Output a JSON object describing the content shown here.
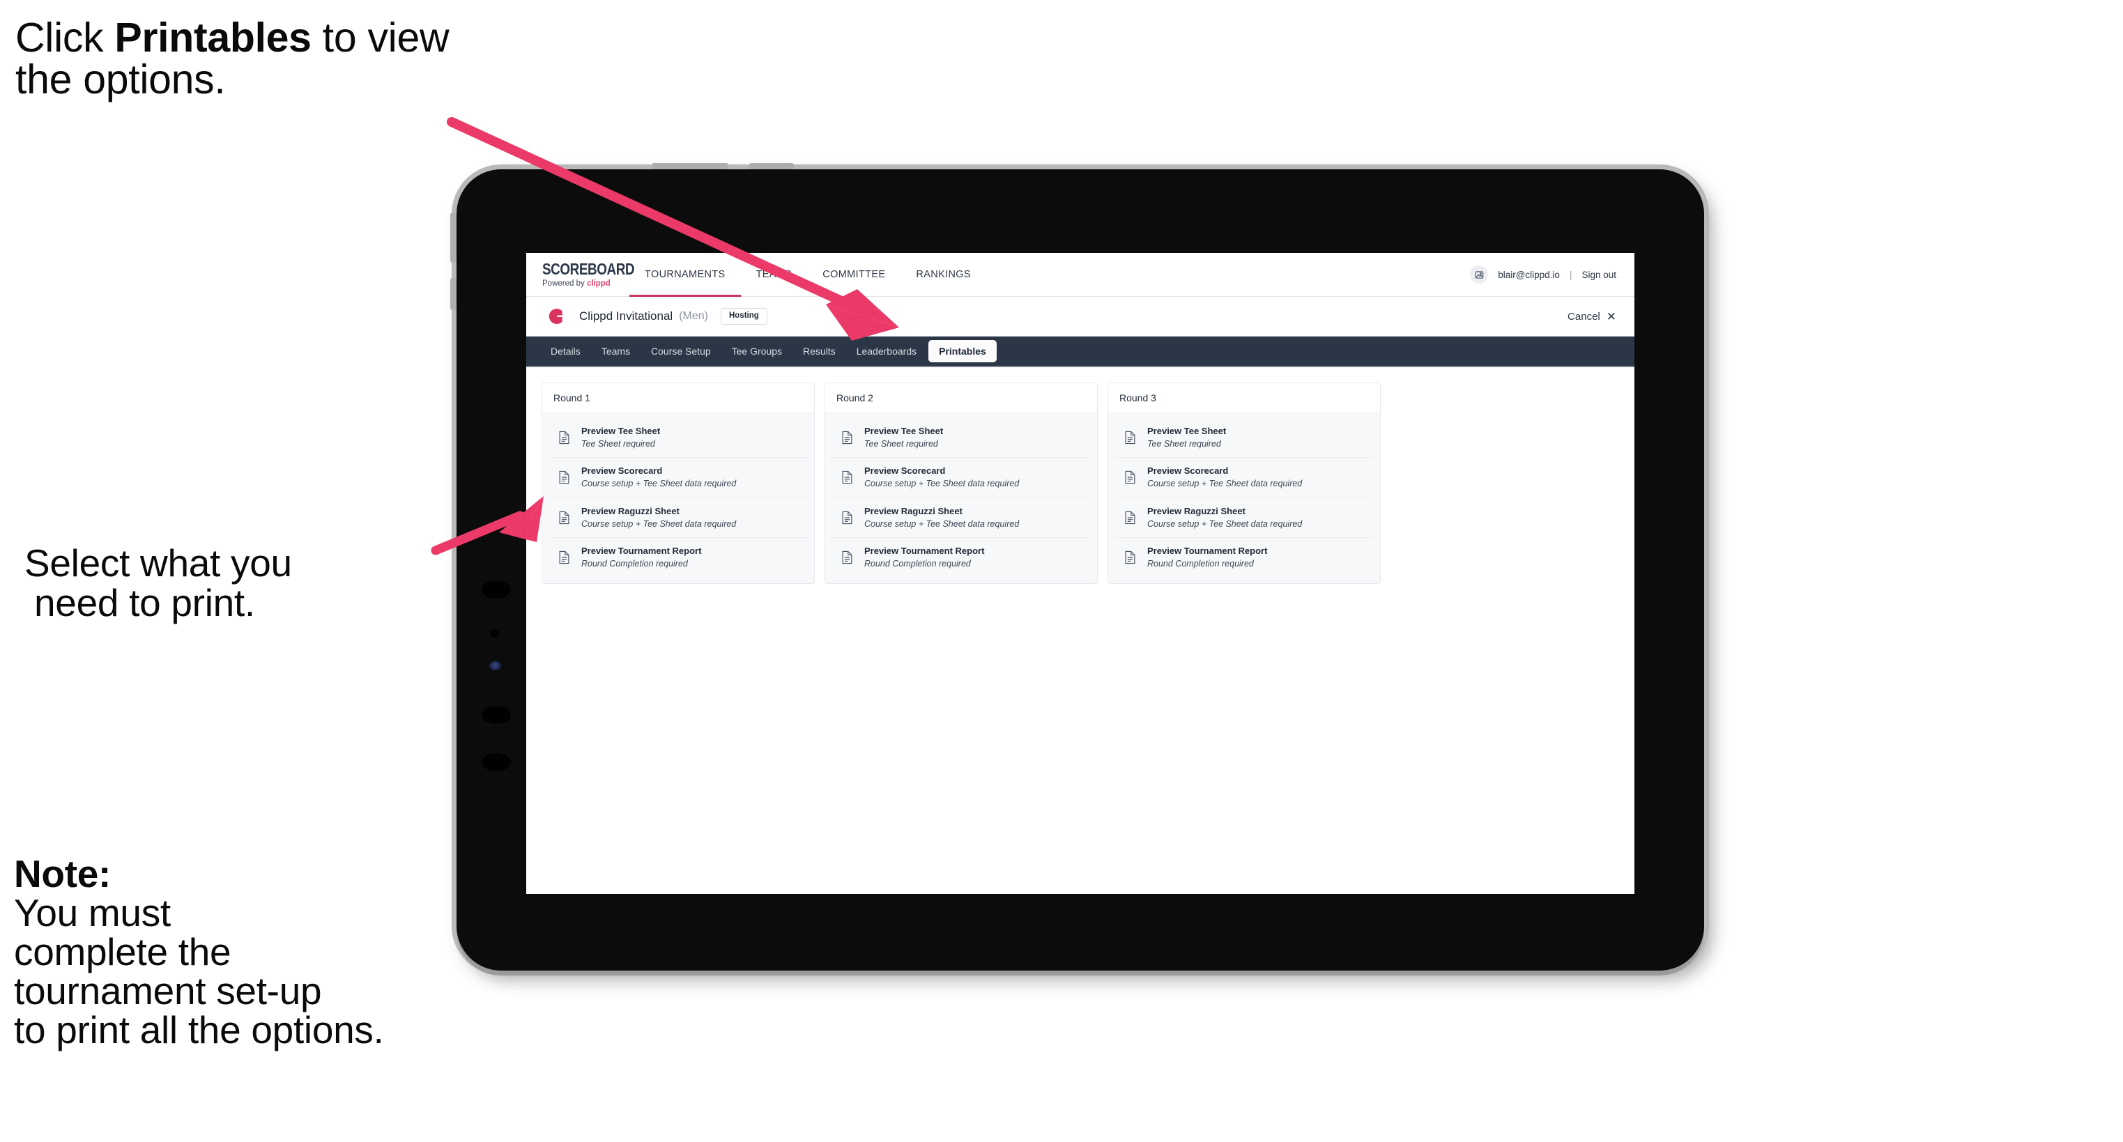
{
  "annotations": {
    "step1": {
      "pre": "Click ",
      "bold": "Printables",
      "post": " to view the options."
    },
    "step2_line1": "Select what you",
    "step2_line2": "need to print.",
    "note": {
      "bold": "Note:",
      "line1": " You must",
      "line2": "complete the",
      "line3": "tournament set-up",
      "line4": "to print all the options."
    }
  },
  "colors": {
    "accent_pink": "#ec3a68",
    "nav_dark": "#2b3647",
    "brand_red": "#e8456c",
    "tab_underline": "#c2385c"
  },
  "app": {
    "brand": {
      "word": "SCOREBOARD",
      "powered_by": "Powered by ",
      "powered_brand": "clippd"
    },
    "main_nav": [
      {
        "label": "TOURNAMENTS",
        "active": true
      },
      {
        "label": "TEAMS",
        "active": false
      },
      {
        "label": "COMMITTEE",
        "active": false
      },
      {
        "label": "RANKINGS",
        "active": false
      }
    ],
    "account": {
      "icon": "user-avatar-icon",
      "email": "blair@clippd.io",
      "separator": "|",
      "sign_out": "Sign out"
    },
    "tournament": {
      "logo": "clippd-c-logo",
      "name": "Clippd Invitational",
      "gender": "(Men)",
      "status_badge": "Hosting",
      "cancel_label": "Cancel",
      "cancel_icon": "close-x-icon"
    },
    "sub_nav": [
      {
        "label": "Details",
        "active": false
      },
      {
        "label": "Teams",
        "active": false
      },
      {
        "label": "Course Setup",
        "active": false
      },
      {
        "label": "Tee Groups",
        "active": false
      },
      {
        "label": "Results",
        "active": false
      },
      {
        "label": "Leaderboards",
        "active": false
      },
      {
        "label": "Printables",
        "active": true
      }
    ],
    "rounds": [
      {
        "title": "Round 1",
        "items": [
          {
            "icon": "document-icon",
            "title": "Preview Tee Sheet",
            "requirement": "Tee Sheet required"
          },
          {
            "icon": "document-icon",
            "title": "Preview Scorecard",
            "requirement": "Course setup + Tee Sheet data required"
          },
          {
            "icon": "document-icon",
            "title": "Preview Raguzzi Sheet",
            "requirement": "Course setup + Tee Sheet data required"
          },
          {
            "icon": "document-icon",
            "title": "Preview Tournament Report",
            "requirement": "Round Completion required"
          }
        ]
      },
      {
        "title": "Round 2",
        "items": [
          {
            "icon": "document-icon",
            "title": "Preview Tee Sheet",
            "requirement": "Tee Sheet required"
          },
          {
            "icon": "document-icon",
            "title": "Preview Scorecard",
            "requirement": "Course setup + Tee Sheet data required"
          },
          {
            "icon": "document-icon",
            "title": "Preview Raguzzi Sheet",
            "requirement": "Course setup + Tee Sheet data required"
          },
          {
            "icon": "document-icon",
            "title": "Preview Tournament Report",
            "requirement": "Round Completion required"
          }
        ]
      },
      {
        "title": "Round 3",
        "items": [
          {
            "icon": "document-icon",
            "title": "Preview Tee Sheet",
            "requirement": "Tee Sheet required"
          },
          {
            "icon": "document-icon",
            "title": "Preview Scorecard",
            "requirement": "Course setup + Tee Sheet data required"
          },
          {
            "icon": "document-icon",
            "title": "Preview Raguzzi Sheet",
            "requirement": "Course setup + Tee Sheet data required"
          },
          {
            "icon": "document-icon",
            "title": "Preview Tournament Report",
            "requirement": "Round Completion required"
          }
        ]
      }
    ]
  }
}
